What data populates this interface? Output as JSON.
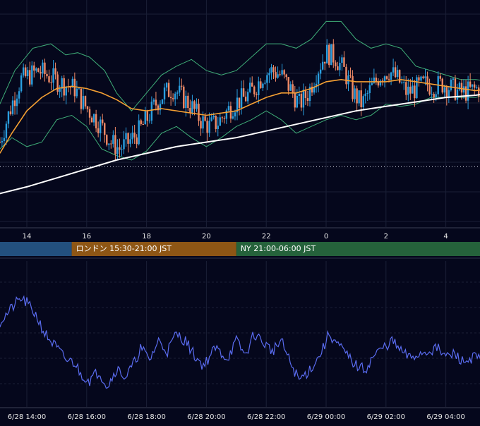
{
  "colors": {
    "background": "#05071c",
    "grid": "#1a1f36",
    "candle_up": "#2a9fe0",
    "candle_down": "#f08a66",
    "ma_short": "#f5a033",
    "ma_long": "#ffffff",
    "bollinger": "#3fae78",
    "oscillator": "#5a6cf0",
    "session_tokyo": "#23507e",
    "session_london": "#8e5615",
    "session_ny": "#25623b",
    "axis_text": "#e6e6e6"
  },
  "sessions": [
    {
      "label": "",
      "start_hour": 11.4,
      "end_hour": 15.5,
      "color": "#23507e"
    },
    {
      "label": "ロンドン 15:30-21:00 JST",
      "start_hour": 15.5,
      "end_hour": 21.0,
      "color": "#8e5615"
    },
    {
      "label": "NY 21:00-06:00 JST",
      "start_hour": 21.0,
      "end_hour": 30.0,
      "color": "#25623b"
    }
  ],
  "chart_data": [
    {
      "type": "candlestick",
      "x_range_hours": [
        13.1,
        29.5
      ],
      "x_ticks": [
        {
          "hour": 14,
          "label": "14"
        },
        {
          "hour": 16,
          "label": "16"
        },
        {
          "hour": 18,
          "label": "18"
        },
        {
          "hour": 20,
          "label": "20"
        },
        {
          "hour": 22,
          "label": "22"
        },
        {
          "hour": 24,
          "label": "0"
        },
        {
          "hour": 26,
          "label": "2"
        },
        {
          "hour": 28,
          "label": "4"
        }
      ],
      "ylim": [
        0,
        100
      ],
      "reference_level": 27,
      "indicators": [
        "moving-average-short",
        "moving-average-long",
        "bollinger-bands"
      ],
      "grid": true
    },
    {
      "type": "line",
      "x_ticks": [
        {
          "hour": 14,
          "label": "6/28 14:00"
        },
        {
          "hour": 16,
          "label": "6/28 16:00"
        },
        {
          "hour": 18,
          "label": "6/28 18:00"
        },
        {
          "hour": 20,
          "label": "6/28 20:00"
        },
        {
          "hour": 22,
          "label": "6/28 22:00"
        },
        {
          "hour": 24,
          "label": "6/29 00:00"
        },
        {
          "hour": 26,
          "label": "6/29 02:00"
        },
        {
          "hour": 28,
          "label": "6/29 04:00"
        }
      ],
      "ylim": [
        0,
        100
      ],
      "keypoints": [
        [
          13.1,
          58
        ],
        [
          13.4,
          65
        ],
        [
          13.6,
          70
        ],
        [
          13.8,
          74
        ],
        [
          14.0,
          71
        ],
        [
          14.3,
          63
        ],
        [
          14.6,
          50
        ],
        [
          15.0,
          40
        ],
        [
          15.3,
          32
        ],
        [
          15.6,
          30
        ],
        [
          15.8,
          22
        ],
        [
          16.1,
          18
        ],
        [
          16.4,
          24
        ],
        [
          16.7,
          14
        ],
        [
          17.0,
          26
        ],
        [
          17.3,
          20
        ],
        [
          17.6,
          30
        ],
        [
          17.8,
          40
        ],
        [
          18.1,
          32
        ],
        [
          18.4,
          45
        ],
        [
          18.7,
          38
        ],
        [
          19.0,
          50
        ],
        [
          19.3,
          45
        ],
        [
          19.6,
          35
        ],
        [
          19.9,
          28
        ],
        [
          20.3,
          40
        ],
        [
          20.7,
          33
        ],
        [
          21.0,
          45
        ],
        [
          21.3,
          35
        ],
        [
          21.6,
          50
        ],
        [
          21.9,
          44
        ],
        [
          22.2,
          38
        ],
        [
          22.5,
          45
        ],
        [
          22.8,
          30
        ],
        [
          23.1,
          18
        ],
        [
          23.4,
          24
        ],
        [
          23.7,
          32
        ],
        [
          23.9,
          40
        ],
        [
          24.1,
          50
        ],
        [
          24.4,
          42
        ],
        [
          24.7,
          35
        ],
        [
          25.0,
          28
        ],
        [
          25.3,
          25
        ],
        [
          25.6,
          35
        ],
        [
          25.9,
          40
        ],
        [
          26.2,
          45
        ],
        [
          26.5,
          38
        ],
        [
          26.8,
          33
        ],
        [
          27.1,
          36
        ],
        [
          27.4,
          38
        ],
        [
          27.7,
          40
        ],
        [
          28.0,
          34
        ],
        [
          28.3,
          36
        ],
        [
          28.6,
          30
        ],
        [
          28.9,
          34
        ],
        [
          29.2,
          32
        ],
        [
          29.5,
          38
        ]
      ],
      "grid": true
    }
  ]
}
